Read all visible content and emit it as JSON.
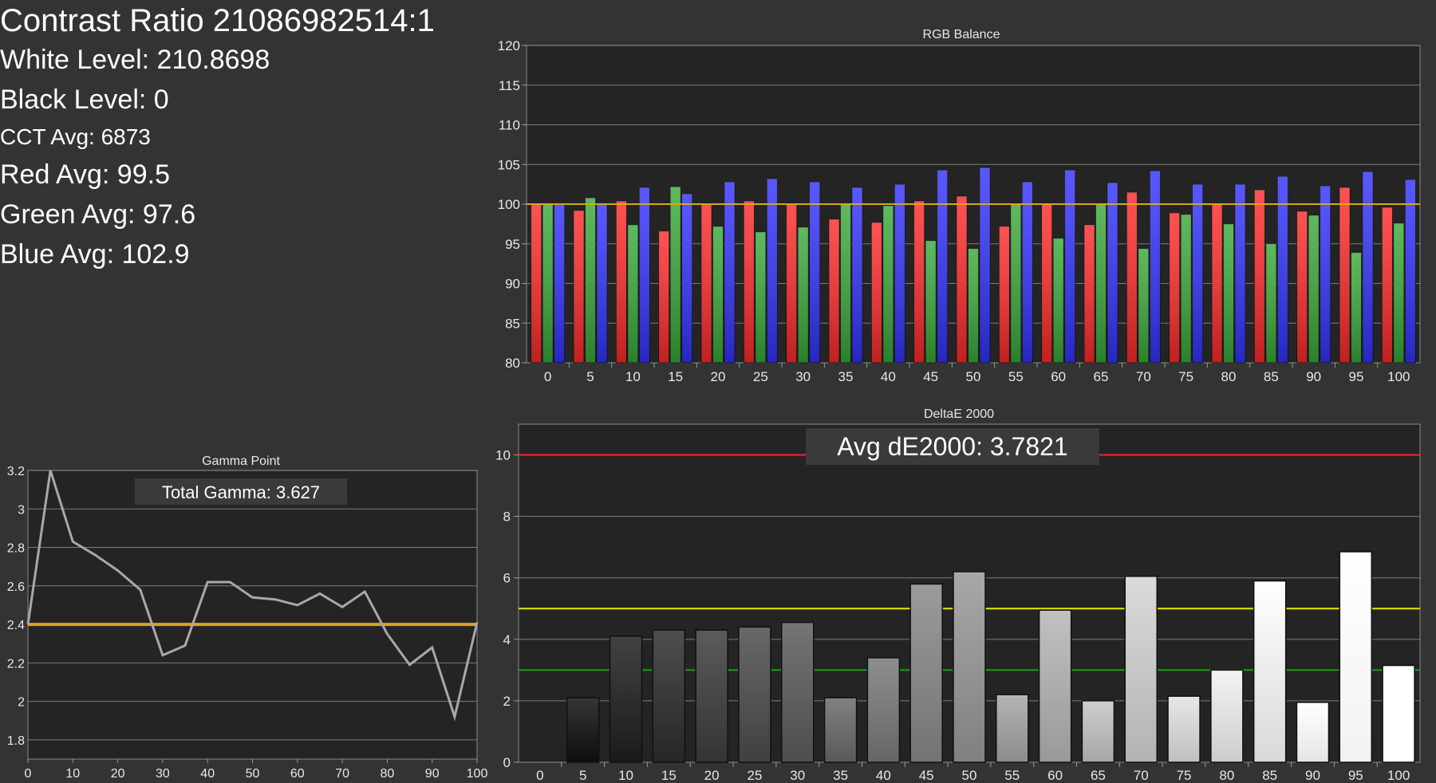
{
  "stats": {
    "contrast_ratio": "Contrast Ratio 21086982514:1",
    "white_level": "White Level: 210.8698",
    "black_level": "Black Level: 0",
    "cct_avg": "CCT Avg: 6873",
    "red_avg": "Red Avg: 99.5",
    "green_avg": "Green Avg: 97.6",
    "blue_avg": "Blue Avg: 102.9"
  },
  "colors": {
    "background": "#333333",
    "plot_bg": "#242424",
    "grid": "#9a9a9a",
    "red": "#ff2b2b",
    "green": "#3aaa3a",
    "blue": "#3333ff",
    "reference_line": "#d9a520"
  },
  "chart_data": [
    {
      "id": "rgb",
      "type": "bar",
      "title": "RGB Balance",
      "categories": [
        "0",
        "5",
        "10",
        "15",
        "20",
        "25",
        "30",
        "35",
        "40",
        "45",
        "50",
        "55",
        "60",
        "65",
        "70",
        "75",
        "80",
        "85",
        "90",
        "95",
        "100"
      ],
      "ylim": [
        80,
        120
      ],
      "yticks": [
        80,
        85,
        90,
        95,
        100,
        105,
        110,
        115,
        120
      ],
      "reference": 100,
      "grid": true,
      "series": [
        {
          "color": "red",
          "values": [
            100,
            99.2,
            100.4,
            96.6,
            100.1,
            100.4,
            100.1,
            98.1,
            97.7,
            100.4,
            101,
            97.2,
            100.1,
            97.4,
            101.5,
            98.9,
            100,
            101.8,
            99.1,
            102.1,
            99.6
          ]
        },
        {
          "color": "green",
          "values": [
            100,
            100.8,
            97.4,
            102.2,
            97.2,
            96.5,
            97.1,
            100,
            99.8,
            95.4,
            94.4,
            100.1,
            95.7,
            100,
            94.4,
            98.7,
            97.5,
            95,
            98.6,
            93.9,
            97.6
          ]
        },
        {
          "color": "blue",
          "values": [
            100,
            100,
            102.1,
            101.3,
            102.8,
            103.2,
            102.8,
            102.1,
            102.5,
            104.3,
            104.6,
            102.8,
            104.3,
            102.7,
            104.2,
            102.5,
            102.5,
            103.5,
            102.3,
            104.1,
            103.1
          ]
        }
      ]
    },
    {
      "id": "gamma",
      "type": "line",
      "title": "Gamma Point",
      "annotation": "Total Gamma: 3.627",
      "x": [
        0,
        5,
        10,
        15,
        20,
        25,
        30,
        35,
        40,
        45,
        50,
        55,
        60,
        65,
        70,
        75,
        80,
        85,
        90,
        95,
        100
      ],
      "y": [
        2.4,
        3.2,
        2.83,
        2.76,
        2.68,
        2.58,
        2.24,
        2.29,
        2.62,
        2.62,
        2.54,
        2.53,
        2.5,
        2.56,
        2.49,
        2.57,
        2.35,
        2.19,
        2.28,
        1.92,
        2.41
      ],
      "xlim": [
        0,
        100
      ],
      "xticks": [
        0,
        10,
        20,
        30,
        40,
        50,
        60,
        70,
        80,
        90,
        100
      ],
      "ylim": [
        1.7,
        3.2
      ],
      "yticks": [
        1.8,
        2,
        2.2,
        2.4,
        2.6,
        2.8,
        3,
        3.2
      ],
      "reference": 2.4,
      "grid": true
    },
    {
      "id": "deltae",
      "type": "bar",
      "title": "DeltaE 2000",
      "annotation": "Avg dE2000: 3.7821",
      "categories": [
        "0",
        "5",
        "10",
        "15",
        "20",
        "25",
        "30",
        "35",
        "40",
        "45",
        "50",
        "55",
        "60",
        "65",
        "70",
        "75",
        "80",
        "85",
        "90",
        "95",
        "100"
      ],
      "values": [
        0,
        2.1,
        4.1,
        4.3,
        4.3,
        4.4,
        4.55,
        2.1,
        3.4,
        5.8,
        6.2,
        2.2,
        4.95,
        2.0,
        6.05,
        2.15,
        3.0,
        5.9,
        1.95,
        6.85,
        3.15
      ],
      "ylim": [
        0,
        11
      ],
      "yticks": [
        0,
        2,
        4,
        6,
        8,
        10
      ],
      "thresholds": [
        {
          "value": 10,
          "color": "#ff2020"
        },
        {
          "value": 5,
          "color": "#e8e800"
        },
        {
          "value": 3,
          "color": "#1f9a1f"
        }
      ],
      "grid": true
    }
  ]
}
